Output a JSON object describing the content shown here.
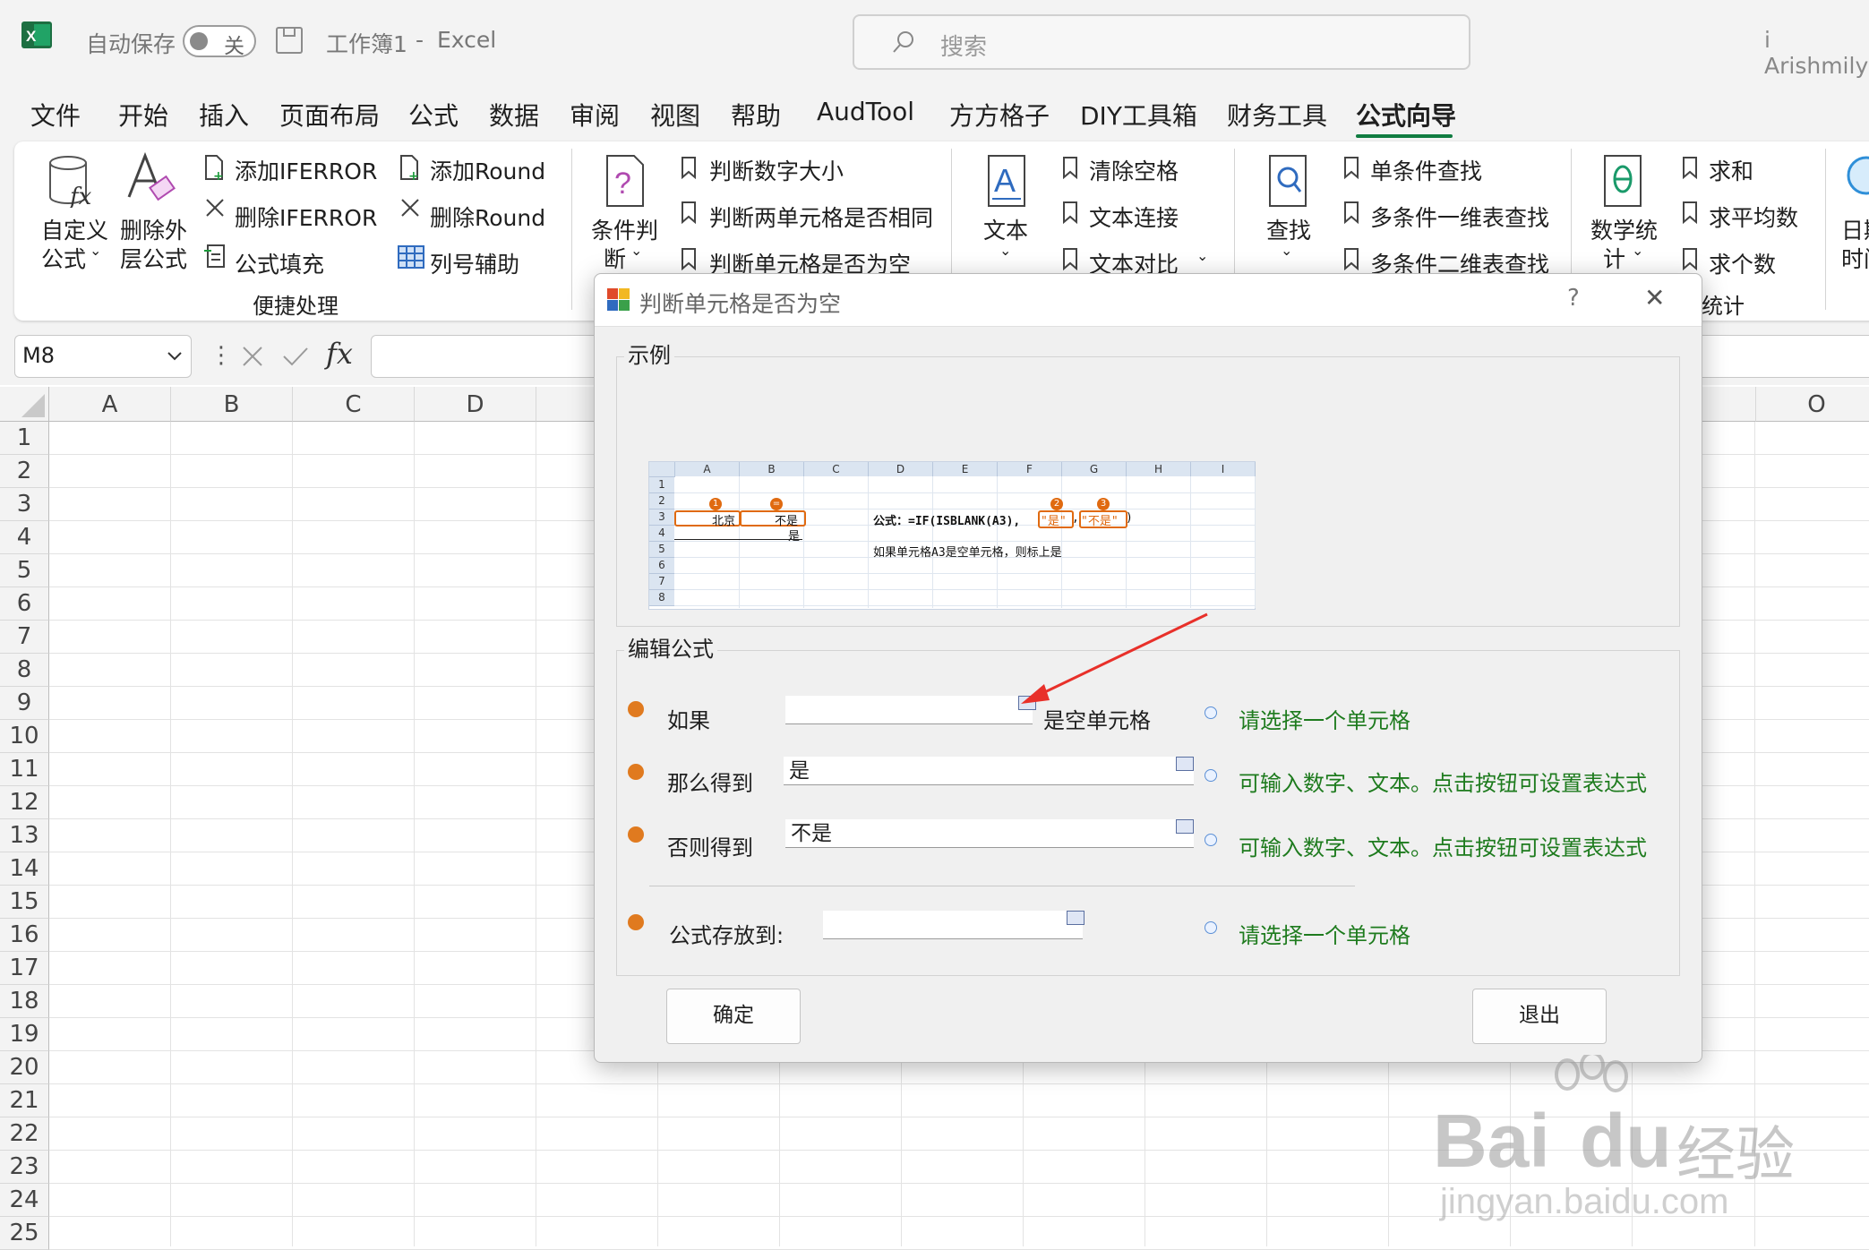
{
  "titlebar": {
    "autosave_label": "自动保存",
    "autosave_toggle": "关",
    "doc_title": "工作簿1",
    "title_sep": "-",
    "app_name": "Excel",
    "search_placeholder": "搜索",
    "user": "i Arishmily"
  },
  "tabs": [
    "文件",
    "开始",
    "插入",
    "页面布局",
    "公式",
    "数据",
    "审阅",
    "视图",
    "帮助",
    "AudTool",
    "方方格子",
    "DIY工具箱",
    "财务工具",
    "公式向导"
  ],
  "active_tab": "公式向导",
  "ribbon": {
    "custom_formula": "自定义\n公式",
    "custom_formula_l1": "自定义",
    "custom_formula_l2": "公式",
    "remove_outer_l1": "删除外",
    "remove_outer_l2": "层公式",
    "add_iferror": "添加IFERROR",
    "remove_iferror": "删除IFERROR",
    "formula_fill": "公式填充",
    "add_round": "添加Round",
    "remove_round": "删除Round",
    "col_helper": "列号辅助",
    "group1_label": "便捷处理",
    "cond_l1": "条件判",
    "cond_l2": "断",
    "cmp_size": "判断数字大小",
    "cmp_two": "判断两单元格是否相同",
    "is_blank": "判断单元格是否为空",
    "text_label": "文本",
    "trim": "清除空格",
    "concat": "文本连接",
    "text_compare": "文本对比",
    "lookup_label": "查找",
    "single_lookup": "单条件查找",
    "multi_1d": "多条件一维表查找",
    "multi_2d": "多条件二维表查找",
    "math_l1": "数学统",
    "math_l2": "计",
    "sum": "求和",
    "average": "求平均数",
    "count": "求个数",
    "stats_label": "统计",
    "date_l1": "日期",
    "date_l2": "时间"
  },
  "formula_bar": {
    "name_box": "M8",
    "fx": "fx"
  },
  "grid": {
    "columns": [
      "A",
      "B",
      "C",
      "D",
      "O"
    ],
    "rows": [
      "1",
      "2",
      "3",
      "4",
      "5",
      "6",
      "7",
      "8",
      "9",
      "10",
      "11",
      "12",
      "13",
      "14",
      "15",
      "16",
      "17",
      "18",
      "19",
      "20",
      "21",
      "22",
      "23",
      "24",
      "25"
    ]
  },
  "dialog": {
    "title": "判断单元格是否为空",
    "help": "?",
    "close": "✕",
    "example_label": "示例",
    "sample": {
      "cols": [
        "A",
        "B",
        "C",
        "D",
        "E",
        "F",
        "G",
        "H",
        "I"
      ],
      "rows": [
        "1",
        "2",
        "3",
        "4",
        "5",
        "6",
        "7",
        "8"
      ],
      "a3": "北京",
      "b3": "不是",
      "b4": "是",
      "formula_prefix": "公式：=IF(ISBLANK(A3),",
      "arg_yes": "\"是\"",
      "arg_comma": ",",
      "arg_no": "\"不是\"",
      "formula_suffix": ")",
      "note": "如果单元格A3是空单元格，则标上是",
      "n1": "1",
      "n2": "2",
      "n3": "3",
      "n_eq": "="
    },
    "edit_label": "编辑公式",
    "if_label": "如果",
    "if_value": "",
    "if_suffix": "是空单元格",
    "if_hint": "请选择一个单元格",
    "then_label": "那么得到",
    "then_value": "是",
    "then_hint": "可输入数字、文本。点击按钮可设置表达式",
    "else_label": "否则得到",
    "else_value": "不是",
    "else_hint": "可输入数字、文本。点击按钮可设置表达式",
    "store_label": "公式存放到:",
    "store_value": "",
    "store_hint": "请选择一个单元格",
    "ok": "确定",
    "exit": "退出"
  },
  "watermark": {
    "brand": "Bai",
    "brand2": "du",
    "suffix": "经验",
    "url": "jingyan.baidu.com"
  },
  "colors": {
    "excel_green": "#107c41",
    "accent_orange": "#e06a10",
    "hint_green": "#1e7b1e",
    "arrow_red": "#e8302a"
  }
}
